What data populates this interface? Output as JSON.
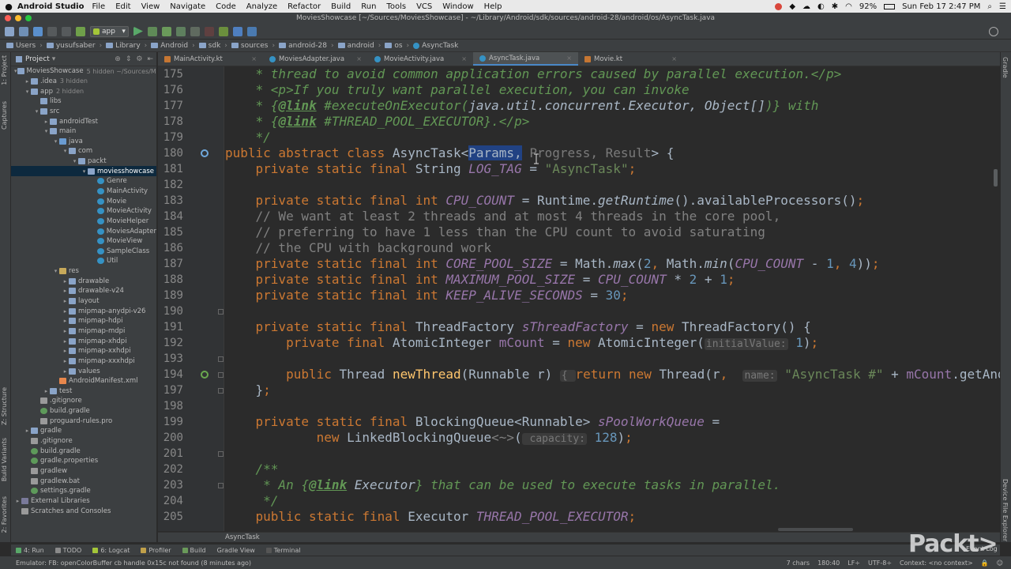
{
  "mac_menubar": {
    "app": "Android Studio",
    "items": [
      "File",
      "Edit",
      "View",
      "Navigate",
      "Code",
      "Analyze",
      "Refactor",
      "Build",
      "Run",
      "Tools",
      "VCS",
      "Window",
      "Help"
    ],
    "battery": "92%",
    "clock": "Sun Feb 17  2:47 PM"
  },
  "window": {
    "title": "MoviesShowcase [~/Sources/MoviesShowcase] - ~/Library/Android/sdk/sources/android-28/android/os/AsyncTask.java"
  },
  "toolbar": {
    "run_config": "app"
  },
  "breadcrumb": [
    "Users",
    "yusufsaber",
    "Library",
    "Android",
    "sdk",
    "sources",
    "android-28",
    "android",
    "os",
    "AsyncTask"
  ],
  "project_panel": {
    "title": "Project",
    "tree": [
      {
        "label": "MoviesShowcase",
        "hint": "5 hidden ~/Sources/Movie",
        "depth": 0,
        "icon": "folder",
        "arrow": "▾"
      },
      {
        "label": ".idea",
        "hint": "3 hidden",
        "depth": 1,
        "icon": "folder",
        "arrow": "▸"
      },
      {
        "label": "app",
        "hint": "2 hidden",
        "depth": 1,
        "icon": "folder",
        "arrow": "▾"
      },
      {
        "label": "libs",
        "hint": "",
        "depth": 2,
        "icon": "folder",
        "arrow": ""
      },
      {
        "label": "src",
        "hint": "",
        "depth": 2,
        "icon": "folder",
        "arrow": "▾"
      },
      {
        "label": "androidTest",
        "hint": "",
        "depth": 3,
        "icon": "folder",
        "arrow": "▸"
      },
      {
        "label": "main",
        "hint": "",
        "depth": 3,
        "icon": "folder",
        "arrow": "▾"
      },
      {
        "label": "java",
        "hint": "",
        "depth": 4,
        "icon": "folder-src",
        "arrow": "▾"
      },
      {
        "label": "com",
        "hint": "",
        "depth": 5,
        "icon": "folder",
        "arrow": "▾"
      },
      {
        "label": "packt",
        "hint": "",
        "depth": 6,
        "icon": "folder",
        "arrow": "▾"
      },
      {
        "label": "moviesshowcase",
        "hint": "",
        "depth": 7,
        "icon": "folder",
        "arrow": "▾",
        "selected": true
      },
      {
        "label": "Genre",
        "hint": "",
        "depth": 8,
        "icon": "class",
        "arrow": ""
      },
      {
        "label": "MainActivity",
        "hint": "",
        "depth": 8,
        "icon": "class",
        "arrow": ""
      },
      {
        "label": "Movie",
        "hint": "",
        "depth": 8,
        "icon": "class",
        "arrow": ""
      },
      {
        "label": "MovieActivity",
        "hint": "",
        "depth": 8,
        "icon": "class",
        "arrow": ""
      },
      {
        "label": "MovieHelper",
        "hint": "",
        "depth": 8,
        "icon": "class",
        "arrow": ""
      },
      {
        "label": "MoviesAdapter",
        "hint": "",
        "depth": 8,
        "icon": "class",
        "arrow": ""
      },
      {
        "label": "MovieView",
        "hint": "",
        "depth": 8,
        "icon": "class",
        "arrow": ""
      },
      {
        "label": "SampleClass",
        "hint": "",
        "depth": 8,
        "icon": "class",
        "arrow": ""
      },
      {
        "label": "Util",
        "hint": "",
        "depth": 8,
        "icon": "class",
        "arrow": ""
      },
      {
        "label": "res",
        "hint": "",
        "depth": 4,
        "icon": "folder-res",
        "arrow": "▾"
      },
      {
        "label": "drawable",
        "hint": "",
        "depth": 5,
        "icon": "folder",
        "arrow": "▸"
      },
      {
        "label": "drawable-v24",
        "hint": "",
        "depth": 5,
        "icon": "folder",
        "arrow": "▸"
      },
      {
        "label": "layout",
        "hint": "",
        "depth": 5,
        "icon": "folder",
        "arrow": "▸"
      },
      {
        "label": "mipmap-anydpi-v26",
        "hint": "",
        "depth": 5,
        "icon": "folder",
        "arrow": "▸"
      },
      {
        "label": "mipmap-hdpi",
        "hint": "",
        "depth": 5,
        "icon": "folder",
        "arrow": "▸"
      },
      {
        "label": "mipmap-mdpi",
        "hint": "",
        "depth": 5,
        "icon": "folder",
        "arrow": "▸"
      },
      {
        "label": "mipmap-xhdpi",
        "hint": "",
        "depth": 5,
        "icon": "folder",
        "arrow": "▸"
      },
      {
        "label": "mipmap-xxhdpi",
        "hint": "",
        "depth": 5,
        "icon": "folder",
        "arrow": "▸"
      },
      {
        "label": "mipmap-xxxhdpi",
        "hint": "",
        "depth": 5,
        "icon": "folder",
        "arrow": "▸"
      },
      {
        "label": "values",
        "hint": "",
        "depth": 5,
        "icon": "folder",
        "arrow": "▸"
      },
      {
        "label": "AndroidManifest.xml",
        "hint": "",
        "depth": 4,
        "icon": "xml",
        "arrow": ""
      },
      {
        "label": "test",
        "hint": "",
        "depth": 3,
        "icon": "folder",
        "arrow": "▸"
      },
      {
        "label": ".gitignore",
        "hint": "",
        "depth": 2,
        "icon": "file",
        "arrow": ""
      },
      {
        "label": "build.gradle",
        "hint": "",
        "depth": 2,
        "icon": "gradle",
        "arrow": ""
      },
      {
        "label": "proguard-rules.pro",
        "hint": "",
        "depth": 2,
        "icon": "file",
        "arrow": ""
      },
      {
        "label": "gradle",
        "hint": "",
        "depth": 1,
        "icon": "folder",
        "arrow": "▸"
      },
      {
        "label": ".gitignore",
        "hint": "",
        "depth": 1,
        "icon": "file",
        "arrow": ""
      },
      {
        "label": "build.gradle",
        "hint": "",
        "depth": 1,
        "icon": "gradle",
        "arrow": ""
      },
      {
        "label": "gradle.properties",
        "hint": "",
        "depth": 1,
        "icon": "gradle",
        "arrow": ""
      },
      {
        "label": "gradlew",
        "hint": "",
        "depth": 1,
        "icon": "file",
        "arrow": ""
      },
      {
        "label": "gradlew.bat",
        "hint": "",
        "depth": 1,
        "icon": "file",
        "arrow": ""
      },
      {
        "label": "settings.gradle",
        "hint": "",
        "depth": 1,
        "icon": "gradle",
        "arrow": ""
      },
      {
        "label": "External Libraries",
        "hint": "",
        "depth": 0,
        "icon": "lib",
        "arrow": "▸"
      },
      {
        "label": "Scratches and Consoles",
        "hint": "",
        "depth": 0,
        "icon": "file",
        "arrow": ""
      }
    ]
  },
  "left_strip": {
    "labels": [
      "1: Project",
      "Captures",
      "Z: Structure",
      "Build Variants",
      "2: Favorites"
    ]
  },
  "right_strip": {
    "labels": [
      "Gradle",
      "Device File Explorer"
    ]
  },
  "tabs": [
    {
      "label": "MainActivity.kt",
      "icon": "kt",
      "active": false
    },
    {
      "label": "MoviesAdapter.java",
      "icon": "java",
      "active": false
    },
    {
      "label": "MovieActivity.java",
      "icon": "java",
      "active": false
    },
    {
      "label": "AsyncTask.java",
      "icon": "java",
      "active": true
    },
    {
      "label": "Movie.kt",
      "icon": "kt",
      "active": false
    }
  ],
  "editor": {
    "line_numbers": [
      "175",
      "176",
      "177",
      "178",
      "179",
      "180",
      "181",
      "182",
      "183",
      "184",
      "185",
      "186",
      "187",
      "188",
      "189",
      "190",
      "191",
      "192",
      "193",
      "194",
      "197",
      "198",
      "199",
      "200",
      "201",
      "202",
      "203",
      "204",
      "205"
    ],
    "lines": [
      [
        {
          "t": "    * thread to avoid common application errors caused by parallel execution.</p>",
          "c": "jd"
        }
      ],
      [
        {
          "t": "    * <p>If you truly want parallel execution, you can invoke",
          "c": "jd"
        }
      ],
      [
        {
          "t": "    * {",
          "c": "jd"
        },
        {
          "t": "@link",
          "c": "jdt"
        },
        {
          "t": " #executeOnExecutor(",
          "c": "jd"
        },
        {
          "t": "java.util.concurrent.Executor, Object[]",
          "c": "jdr"
        },
        {
          "t": ")} with",
          "c": "jd"
        }
      ],
      [
        {
          "t": "    * {",
          "c": "jd"
        },
        {
          "t": "@link",
          "c": "jdt"
        },
        {
          "t": " #THREAD_POOL_EXECUTOR}.</p>",
          "c": "jd"
        }
      ],
      [
        {
          "t": "    */",
          "c": "jd"
        }
      ],
      [
        {
          "t": "public abstract class ",
          "c": "kw"
        },
        {
          "t": "AsyncTask<",
          "c": ""
        },
        {
          "t": "Params",
          "c": "hl-typ"
        },
        {
          "t": ",",
          "c": "hl"
        },
        {
          "t": " Progress, Result",
          "c": "typ-dim"
        },
        {
          "t": "> {",
          "c": ""
        }
      ],
      [
        {
          "t": "    private static final ",
          "c": "kw"
        },
        {
          "t": "String ",
          "c": ""
        },
        {
          "t": "LOG_TAG",
          "c": "fi"
        },
        {
          "t": " = ",
          "c": ""
        },
        {
          "t": "\"AsyncTask\"",
          "c": "st"
        },
        {
          "t": ";",
          "c": "kw"
        }
      ],
      [
        {
          "t": "",
          "c": ""
        }
      ],
      [
        {
          "t": "    private static final int ",
          "c": "kw"
        },
        {
          "t": "CPU_COUNT",
          "c": "fi"
        },
        {
          "t": " = Runtime.",
          "c": ""
        },
        {
          "t": "getRuntime",
          "c": "it"
        },
        {
          "t": "().availableProcessors()",
          "c": ""
        },
        {
          "t": ";",
          "c": "kw"
        }
      ],
      [
        {
          "t": "    // We want at least 2 threads and at most 4 threads in the core pool,",
          "c": "cm"
        }
      ],
      [
        {
          "t": "    // preferring to have 1 less than the CPU count to avoid saturating",
          "c": "cm"
        }
      ],
      [
        {
          "t": "    // the CPU with background work",
          "c": "cm"
        }
      ],
      [
        {
          "t": "    private static final int ",
          "c": "kw"
        },
        {
          "t": "CORE_POOL_SIZE",
          "c": "fi"
        },
        {
          "t": " = Math.",
          "c": ""
        },
        {
          "t": "max",
          "c": "it"
        },
        {
          "t": "(",
          "c": ""
        },
        {
          "t": "2",
          "c": "nm"
        },
        {
          "t": ", ",
          "c": "kw"
        },
        {
          "t": "Math.",
          "c": ""
        },
        {
          "t": "min",
          "c": "it"
        },
        {
          "t": "(",
          "c": ""
        },
        {
          "t": "CPU_COUNT",
          "c": "fi"
        },
        {
          "t": " - ",
          "c": ""
        },
        {
          "t": "1",
          "c": "nm"
        },
        {
          "t": ", ",
          "c": "kw"
        },
        {
          "t": "4",
          "c": "nm"
        },
        {
          "t": "))",
          "c": ""
        },
        {
          "t": ";",
          "c": "kw"
        }
      ],
      [
        {
          "t": "    private static final int ",
          "c": "kw"
        },
        {
          "t": "MAXIMUM_POOL_SIZE",
          "c": "fi"
        },
        {
          "t": " = ",
          "c": ""
        },
        {
          "t": "CPU_COUNT",
          "c": "fi"
        },
        {
          "t": " * ",
          "c": ""
        },
        {
          "t": "2",
          "c": "nm"
        },
        {
          "t": " + ",
          "c": ""
        },
        {
          "t": "1",
          "c": "nm"
        },
        {
          "t": ";",
          "c": "kw"
        }
      ],
      [
        {
          "t": "    private static final int ",
          "c": "kw"
        },
        {
          "t": "KEEP_ALIVE_SECONDS",
          "c": "fi"
        },
        {
          "t": " = ",
          "c": ""
        },
        {
          "t": "30",
          "c": "nm"
        },
        {
          "t": ";",
          "c": "kw"
        }
      ],
      [
        {
          "t": "",
          "c": ""
        }
      ],
      [
        {
          "t": "    private static final ",
          "c": "kw"
        },
        {
          "t": "ThreadFactory ",
          "c": ""
        },
        {
          "t": "sThreadFactory",
          "c": "fi"
        },
        {
          "t": " = ",
          "c": ""
        },
        {
          "t": "new ",
          "c": "kw"
        },
        {
          "t": "ThreadFactory() {",
          "c": ""
        }
      ],
      [
        {
          "t": "        private final ",
          "c": "kw"
        },
        {
          "t": "AtomicInteger ",
          "c": ""
        },
        {
          "t": "mCount",
          "c": "fd"
        },
        {
          "t": " = ",
          "c": ""
        },
        {
          "t": "new ",
          "c": "kw"
        },
        {
          "t": "AtomicInteger(",
          "c": ""
        },
        {
          "t": "initialValue:",
          "c": "hint"
        },
        {
          "t": " ",
          "c": ""
        },
        {
          "t": "1",
          "c": "nm"
        },
        {
          "t": ")",
          "c": ""
        },
        {
          "t": ";",
          "c": "kw"
        }
      ],
      [
        {
          "t": "",
          "c": ""
        }
      ],
      [
        {
          "t": "        public ",
          "c": "kw"
        },
        {
          "t": "Thread ",
          "c": ""
        },
        {
          "t": "newThread",
          "c": "mth"
        },
        {
          "t": "(Runnable r) ",
          "c": ""
        },
        {
          "t": "{ ",
          "c": "hint"
        },
        {
          "t": "return new ",
          "c": "kw"
        },
        {
          "t": "Thread(r",
          "c": ""
        },
        {
          "t": ",  ",
          "c": "kw"
        },
        {
          "t": "name:",
          "c": "hint"
        },
        {
          "t": " ",
          "c": ""
        },
        {
          "t": "\"AsyncTask #\"",
          "c": "st"
        },
        {
          "t": " + ",
          "c": ""
        },
        {
          "t": "mCount",
          "c": "fd"
        },
        {
          "t": ".getAndIncrement())",
          "c": ""
        }
      ],
      [
        {
          "t": "    }",
          "c": ""
        },
        {
          "t": ";",
          "c": "kw"
        }
      ],
      [
        {
          "t": "",
          "c": ""
        }
      ],
      [
        {
          "t": "    private static final ",
          "c": "kw"
        },
        {
          "t": "BlockingQueue<Runnable> ",
          "c": ""
        },
        {
          "t": "sPoolWorkQueue",
          "c": "fi"
        },
        {
          "t": " =",
          "c": ""
        }
      ],
      [
        {
          "t": "            new ",
          "c": "kw"
        },
        {
          "t": "LinkedBlockingQueue",
          "c": ""
        },
        {
          "t": "<~>",
          "c": "cm"
        },
        {
          "t": "(",
          "c": ""
        },
        {
          "t": " capacity:",
          "c": "hint"
        },
        {
          "t": " ",
          "c": ""
        },
        {
          "t": "128",
          "c": "nm"
        },
        {
          "t": ")",
          "c": ""
        },
        {
          "t": ";",
          "c": "kw"
        }
      ],
      [
        {
          "t": "",
          "c": ""
        }
      ],
      [
        {
          "t": "    /**",
          "c": "jd"
        }
      ],
      [
        {
          "t": "     * An {",
          "c": "jd"
        },
        {
          "t": "@link",
          "c": "jdt"
        },
        {
          "t": " ",
          "c": "jd"
        },
        {
          "t": "Executor",
          "c": "jdr"
        },
        {
          "t": "} that can be used to execute tasks in parallel.",
          "c": "jd"
        }
      ],
      [
        {
          "t": "     */",
          "c": "jd"
        }
      ],
      [
        {
          "t": "    public static final ",
          "c": "kw"
        },
        {
          "t": "Executor ",
          "c": ""
        },
        {
          "t": "THREAD_POOL_EXECUTOR",
          "c": "fi"
        },
        {
          "t": ";",
          "c": "kw"
        }
      ]
    ]
  },
  "editor_crumb": "AsyncTask",
  "tool_tabs": [
    "4: Run",
    "TODO",
    "6: Logcat",
    "Profiler",
    "Build",
    "Gradle View",
    "Terminal"
  ],
  "status": {
    "message": "Emulator: FB: openColorBuffer cb handle 0x15c not found (8 minutes ago)",
    "chars": "7 chars",
    "position": "180:40",
    "line_sep": "LF÷",
    "encoding": "UTF-8÷",
    "context": "Context: <no context>"
  },
  "watermark": "Packt>",
  "event_log": "Event Log",
  "colors": {
    "keyword": "#cc7832",
    "javadoc": "#629755",
    "string": "#6a8759",
    "field": "#9876aa",
    "number": "#6897bb",
    "method": "#ffc66d",
    "comment": "#808080",
    "selection": "#214283"
  }
}
